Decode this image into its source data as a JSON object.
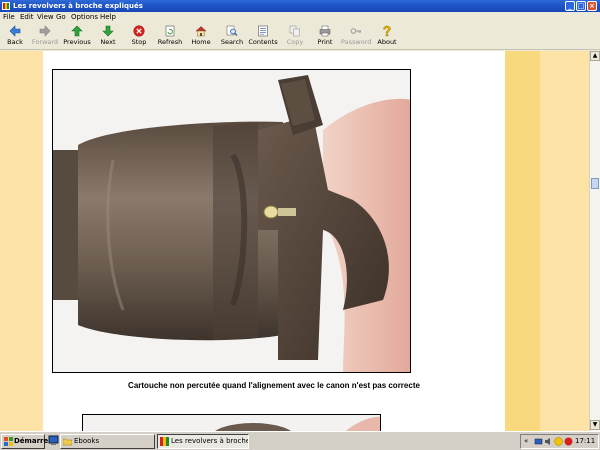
{
  "window": {
    "title": "Les revolvers à broche expliqués"
  },
  "menu": [
    "File",
    "Edit",
    "View",
    "Go",
    "Options",
    "Help"
  ],
  "toolbar": [
    {
      "label": "Back",
      "icon": "back-arrow-icon",
      "disabled": false
    },
    {
      "label": "Forward",
      "icon": "forward-arrow-icon",
      "disabled": true
    },
    {
      "label": "Previous",
      "icon": "up-arrow-icon",
      "disabled": false
    },
    {
      "label": "Next",
      "icon": "down-arrow-icon",
      "disabled": false
    },
    {
      "label": "Stop",
      "icon": "stop-icon",
      "disabled": false
    },
    {
      "label": "Refresh",
      "icon": "refresh-icon",
      "disabled": false
    },
    {
      "label": "Home",
      "icon": "home-icon",
      "disabled": false
    },
    {
      "label": "Search",
      "icon": "search-icon",
      "disabled": false
    },
    {
      "label": "Contents",
      "icon": "contents-icon",
      "disabled": false
    },
    {
      "label": "Copy",
      "icon": "copy-icon",
      "disabled": true
    },
    {
      "label": "Print",
      "icon": "printer-icon",
      "disabled": false
    },
    {
      "label": "Password",
      "icon": "key-icon",
      "disabled": true
    },
    {
      "label": "About",
      "icon": "about-icon",
      "disabled": false
    }
  ],
  "content": {
    "caption": "Cartouche non percutée quand l'alignement avec le canon n'est pas correcte"
  },
  "taskbar": {
    "start_label": "Démarrer",
    "tasks": [
      {
        "label": "Ebooks",
        "active": false
      },
      {
        "label": "Les revolvers à broche...",
        "active": true
      }
    ],
    "tray_chevron": "«",
    "clock": "17:11"
  },
  "colors": {
    "page_background": "#fde3a5",
    "stripe": "#f8d97e",
    "title_bar": "#1f55c8"
  }
}
